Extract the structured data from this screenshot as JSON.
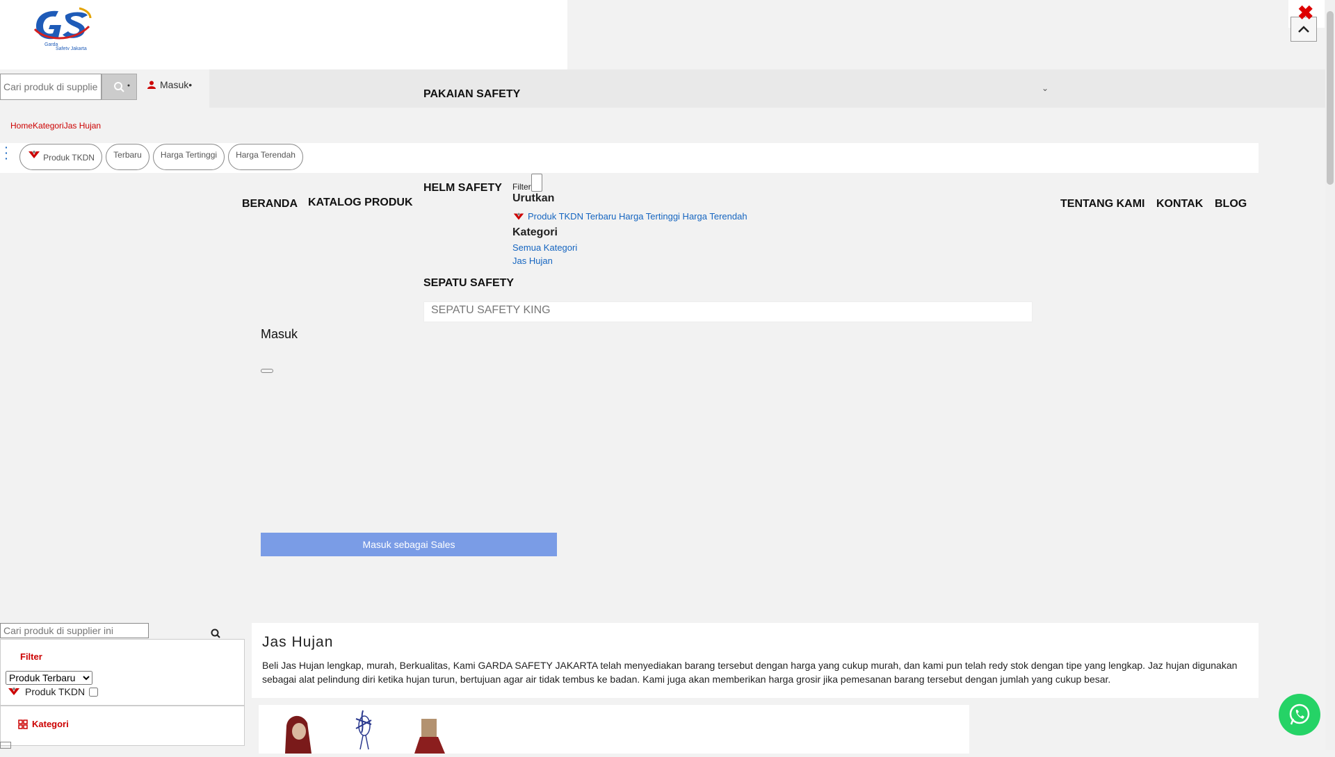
{
  "header": {
    "logo_alt": "Garda Safety Jakarta",
    "search_placeholder": "Cari produk di supplier",
    "login_label": "Masuk",
    "nav_pakaian": "PAKAIAN SAFETY"
  },
  "breadcrumb": [
    "Home",
    "Kategori",
    "Jas Hujan"
  ],
  "chips": [
    "Produk TKDN",
    "Terbaru",
    "Harga Tertinggi",
    "Harga Terendah"
  ],
  "main_nav": {
    "beranda": "BERANDA",
    "katalog": "KATALOG PRODUK",
    "helm": "HELM SAFETY",
    "sepatu": "SEPATU SAFETY",
    "tentang": "TENTANG KAMI",
    "kontak": "KONTAK",
    "blog": "BLOG"
  },
  "filter_panel": {
    "filter_label": "Filter",
    "urutkan_title": "Urutkan",
    "urutkan_items": "Produk TKDN Terbaru Harga Tertinggi Harga Terendah",
    "kategori_title": "Kategori",
    "kategori_items": [
      "Semua Kategori",
      "Jas Hujan"
    ]
  },
  "sepatu_submenu": "SEPATU SAFETY KING",
  "login_modal": {
    "title": "Masuk",
    "sales_button": "Masuk sebagai Sales"
  },
  "sidebar": {
    "search_placeholder": "Cari produk di supplier ini",
    "filter_label": "Filter",
    "sort_selected": "Produk Terbaru",
    "tkdn_label": "Produk TKDN",
    "kategori_label": "Kategori"
  },
  "content": {
    "title": "Jas Hujan",
    "description": "Beli Jas Hujan  lengkap, murah, Berkualitas, Kami GARDA SAFETY JAKARTA telah menyediakan barang tersebut dengan harga yang cukup murah, dan kami pun telah redy stok dengan tipe yang lengkap. Jaz hujan digunakan sebagai alat pelindung diri ketika hujan turun, bertujuan agar air tidak tembus ke badan. Kami juga akan memberikan harga grosir jika pemesanan barang tersebut dengan jumlah yang cukup besar."
  },
  "colors": {
    "accent_red": "#cc0000",
    "link_blue": "#1565c0",
    "sales_blue": "#7a9ce6",
    "whatsapp": "#25d366"
  }
}
